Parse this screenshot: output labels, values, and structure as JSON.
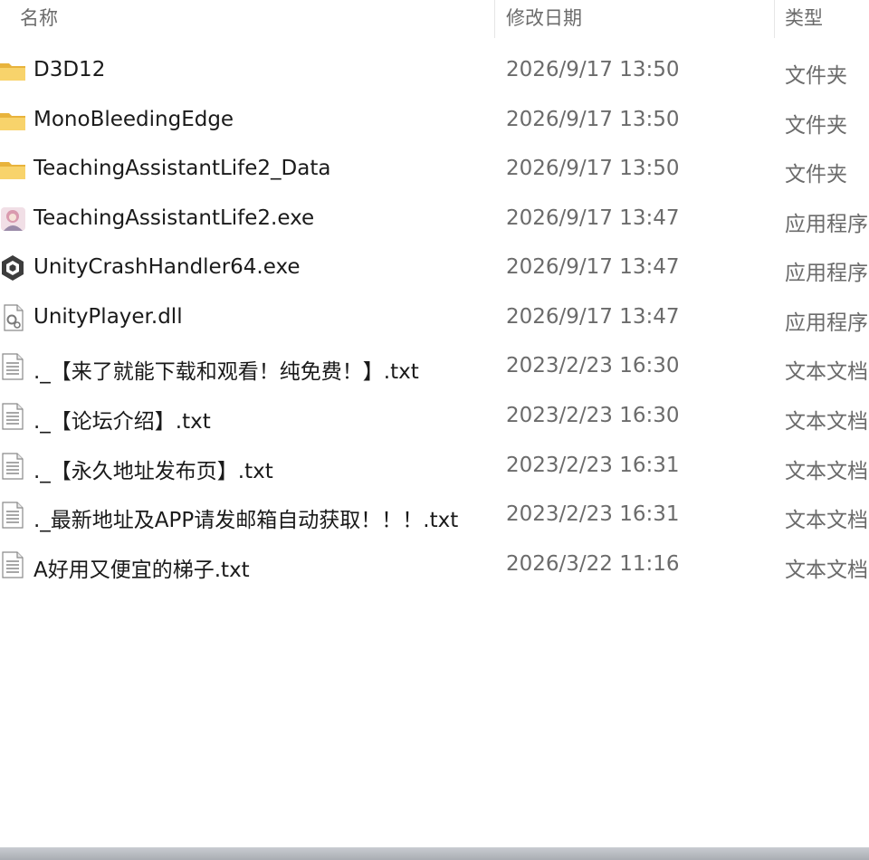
{
  "header": {
    "name": "名称",
    "date": "修改日期",
    "type": "类型"
  },
  "files": [
    {
      "name": "D3D12",
      "date": "2026/9/17 13:50",
      "type": "文件夹",
      "icon": "folder-icon"
    },
    {
      "name": "MonoBleedingEdge",
      "date": "2026/9/17 13:50",
      "type": "文件夹",
      "icon": "folder-icon"
    },
    {
      "name": "TeachingAssistantLife2_Data",
      "date": "2026/9/17 13:50",
      "type": "文件夹",
      "icon": "folder-icon"
    },
    {
      "name": "TeachingAssistantLife2.exe",
      "date": "2026/9/17 13:47",
      "type": "应用程序",
      "icon": "app-icon"
    },
    {
      "name": "UnityCrashHandler64.exe",
      "date": "2026/9/17 13:47",
      "type": "应用程序",
      "icon": "unity-icon"
    },
    {
      "name": "UnityPlayer.dll",
      "date": "2026/9/17 13:47",
      "type": "应用程序",
      "icon": "dll-file-icon"
    },
    {
      "name": "._【来了就能下载和观看！纯免费！】.txt",
      "date": "2023/2/23 16:30",
      "type": "文本文档",
      "icon": "text-file-icon"
    },
    {
      "name": "._【论坛介绍】.txt",
      "date": "2023/2/23 16:30",
      "type": "文本文档",
      "icon": "text-file-icon"
    },
    {
      "name": "._【永久地址发布页】.txt",
      "date": "2023/2/23 16:31",
      "type": "文本文档",
      "icon": "text-file-icon"
    },
    {
      "name": "._最新地址及APP请发邮箱自动获取！！！.txt",
      "date": "2023/2/23 16:31",
      "type": "文本文档",
      "icon": "text-file-icon"
    },
    {
      "name": "A好用又便宜的梯子.txt",
      "date": "2026/3/22 11:16",
      "type": "文本文档",
      "icon": "text-file-icon"
    }
  ]
}
